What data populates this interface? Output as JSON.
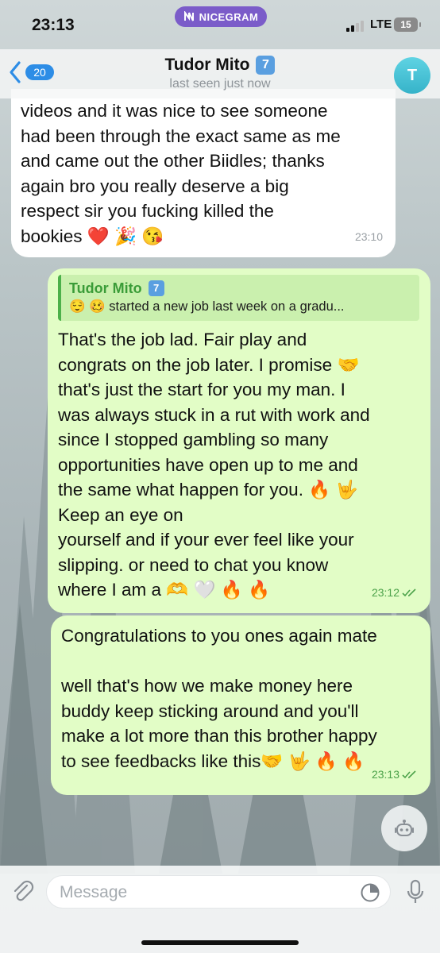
{
  "status_bar": {
    "time": "23:13",
    "app_pill": "NICEGRAM",
    "network": "LTE",
    "battery": "15"
  },
  "header": {
    "back_badge": "20",
    "contact_name": "Tudor Mito",
    "contact_badge": "7",
    "last_seen": "last seen just now",
    "avatar_letter": "T"
  },
  "messages": [
    {
      "direction": "incoming",
      "text": "videos and it was nice to see someone\nhad been through the exact same as me\nand came out the other Biidles; thanks\nagain bro you really deserve a big\nrespect sir you fucking killed the\nbookies ❤️ 🎉 😘",
      "time": "23:10"
    },
    {
      "direction": "outgoing",
      "reply_to": {
        "name": "Tudor Mito",
        "badge": "7",
        "text": "😌 🥴 started a new job last week on a gradu..."
      },
      "text": "That's the job lad. Fair play and\ncongrats on the job later. I promise 🤝\nthat's just the start for you my man. I\nwas always stuck in a rut with work and\nsince I stopped gambling so many\nopportunities have open up to me and\nthe same what happen for you. 🔥 🤟\nKeep an eye on\nyourself and if your ever feel like your\nslipping. or need to chat you know\nwhere I am a 🫶 🤍 🔥 🔥",
      "time": "23:12"
    },
    {
      "direction": "outgoing",
      "text": "Congratulations to you ones again mate\n\nwell that's how we make money here\nbuddy keep sticking around and you'll\nmake a lot more than this brother happy\nto see feedbacks like this🤝 🤟 🔥 🔥",
      "time": "23:13"
    }
  ],
  "input": {
    "placeholder": "Message"
  },
  "colors": {
    "incoming_bubble": "#ffffff",
    "outgoing_bubble": "#e2fdc6",
    "accent_blue": "#2d8de6",
    "pill_purple": "#7b5cc9",
    "reply_green": "#3a9c38"
  },
  "icons": [
    "nicegram-logo-icon",
    "signal-icon",
    "chevron-left-icon",
    "double-check-icon",
    "bot-icon",
    "paperclip-icon",
    "sticker-icon",
    "microphone-icon"
  ]
}
